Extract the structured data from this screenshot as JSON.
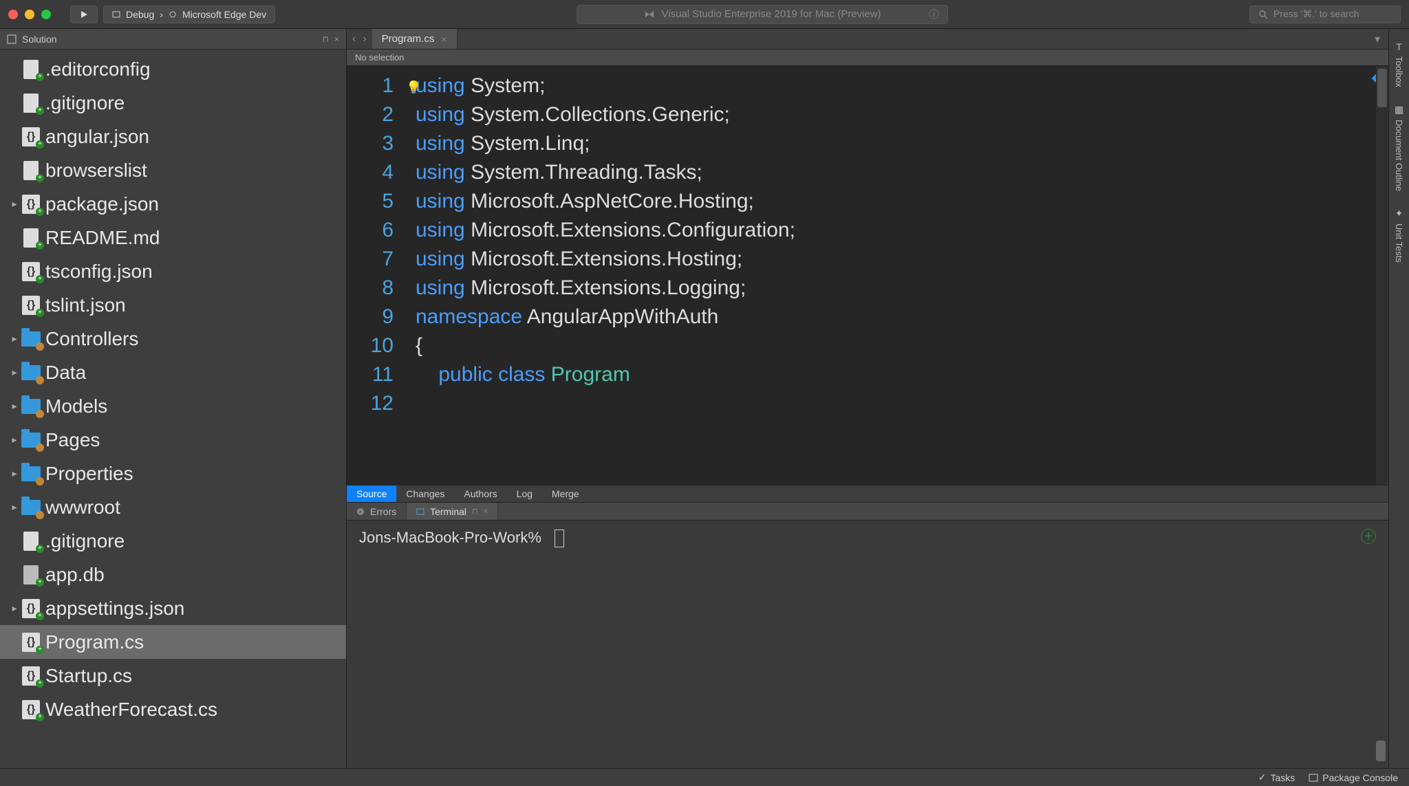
{
  "titlebar": {
    "debug_label": "Debug",
    "target": "Microsoft Edge Dev",
    "app_title": "Visual Studio Enterprise 2019 for Mac (Preview)",
    "search_placeholder": "Press '⌘.' to search"
  },
  "sidebar": {
    "title": "Solution",
    "items": [
      {
        "label": ".editorconfig",
        "type": "file",
        "badge": "add",
        "expandable": false
      },
      {
        "label": ".gitignore",
        "type": "file",
        "badge": "add",
        "expandable": false
      },
      {
        "label": "angular.json",
        "type": "json",
        "badge": "add",
        "expandable": false
      },
      {
        "label": "browserslist",
        "type": "file",
        "badge": "add",
        "expandable": false
      },
      {
        "label": "package.json",
        "type": "json",
        "badge": "add",
        "expandable": true
      },
      {
        "label": "README.md",
        "type": "file",
        "badge": "add",
        "expandable": false
      },
      {
        "label": "tsconfig.json",
        "type": "json",
        "badge": "add",
        "expandable": false
      },
      {
        "label": "tslint.json",
        "type": "json",
        "badge": "add",
        "expandable": false
      },
      {
        "label": "Controllers",
        "type": "folder",
        "badge": "mod",
        "expandable": true
      },
      {
        "label": "Data",
        "type": "folder",
        "badge": "mod",
        "expandable": true
      },
      {
        "label": "Models",
        "type": "folder",
        "badge": "mod",
        "expandable": true
      },
      {
        "label": "Pages",
        "type": "folder",
        "badge": "mod",
        "expandable": true
      },
      {
        "label": "Properties",
        "type": "folder",
        "badge": "mod",
        "expandable": true
      },
      {
        "label": "wwwroot",
        "type": "folder",
        "badge": "mod",
        "expandable": true
      },
      {
        "label": ".gitignore",
        "type": "file",
        "badge": "add",
        "expandable": false
      },
      {
        "label": "app.db",
        "type": "blank",
        "badge": "add",
        "expandable": false
      },
      {
        "label": "appsettings.json",
        "type": "json",
        "badge": "add",
        "expandable": true
      },
      {
        "label": "Program.cs",
        "type": "json",
        "badge": "add",
        "expandable": false,
        "selected": true
      },
      {
        "label": "Startup.cs",
        "type": "json",
        "badge": "add",
        "expandable": false
      },
      {
        "label": "WeatherForecast.cs",
        "type": "json",
        "badge": "add",
        "expandable": false
      }
    ]
  },
  "editor": {
    "tab_label": "Program.cs",
    "breadcrumb": "No selection",
    "lines": [
      {
        "n": 1,
        "tokens": [
          [
            "kw",
            "using"
          ],
          [
            "sp",
            " "
          ],
          [
            "type",
            "System"
          ],
          [
            "p",
            ";"
          ]
        ]
      },
      {
        "n": 2,
        "tokens": [
          [
            "kw",
            "using"
          ],
          [
            "sp",
            " "
          ],
          [
            "type",
            "System.Collections.Generic"
          ],
          [
            "p",
            ";"
          ]
        ]
      },
      {
        "n": 3,
        "tokens": [
          [
            "kw",
            "using"
          ],
          [
            "sp",
            " "
          ],
          [
            "type",
            "System.Linq"
          ],
          [
            "p",
            ";"
          ]
        ]
      },
      {
        "n": 4,
        "tokens": [
          [
            "kw",
            "using"
          ],
          [
            "sp",
            " "
          ],
          [
            "type",
            "System.Threading.Tasks"
          ],
          [
            "p",
            ";"
          ]
        ]
      },
      {
        "n": 5,
        "tokens": [
          [
            "kw",
            "using"
          ],
          [
            "sp",
            " "
          ],
          [
            "type",
            "Microsoft.AspNetCore.Hosting"
          ],
          [
            "p",
            ";"
          ]
        ]
      },
      {
        "n": 6,
        "tokens": [
          [
            "kw",
            "using"
          ],
          [
            "sp",
            " "
          ],
          [
            "type",
            "Microsoft.Extensions.Configuration"
          ],
          [
            "p",
            ";"
          ]
        ]
      },
      {
        "n": 7,
        "tokens": [
          [
            "kw",
            "using"
          ],
          [
            "sp",
            " "
          ],
          [
            "type",
            "Microsoft.Extensions.Hosting"
          ],
          [
            "p",
            ";"
          ]
        ]
      },
      {
        "n": 8,
        "tokens": [
          [
            "kw",
            "using"
          ],
          [
            "sp",
            " "
          ],
          [
            "type",
            "Microsoft.Extensions.Logging"
          ],
          [
            "p",
            ";"
          ]
        ]
      },
      {
        "n": 9,
        "tokens": []
      },
      {
        "n": 10,
        "tokens": [
          [
            "ns",
            "namespace"
          ],
          [
            "sp",
            " "
          ],
          [
            "type",
            "AngularAppWithAuth"
          ]
        ]
      },
      {
        "n": 11,
        "tokens": [
          [
            "p",
            "{"
          ]
        ]
      },
      {
        "n": 12,
        "tokens": [
          [
            "sp",
            "    "
          ],
          [
            "kw",
            "public"
          ],
          [
            "sp",
            " "
          ],
          [
            "kw",
            "class"
          ],
          [
            "sp",
            " "
          ],
          [
            "cls",
            "Program"
          ]
        ]
      }
    ]
  },
  "source_tabs": [
    "Source",
    "Changes",
    "Authors",
    "Log",
    "Merge"
  ],
  "panel_tabs": {
    "errors": "Errors",
    "terminal": "Terminal"
  },
  "terminal": {
    "prompt": "Jons-MacBook-Pro-Work%"
  },
  "right_rail": [
    "Toolbox",
    "Document Outline",
    "Unit Tests"
  ],
  "statusbar": {
    "tasks": "Tasks",
    "package_console": "Package Console"
  }
}
